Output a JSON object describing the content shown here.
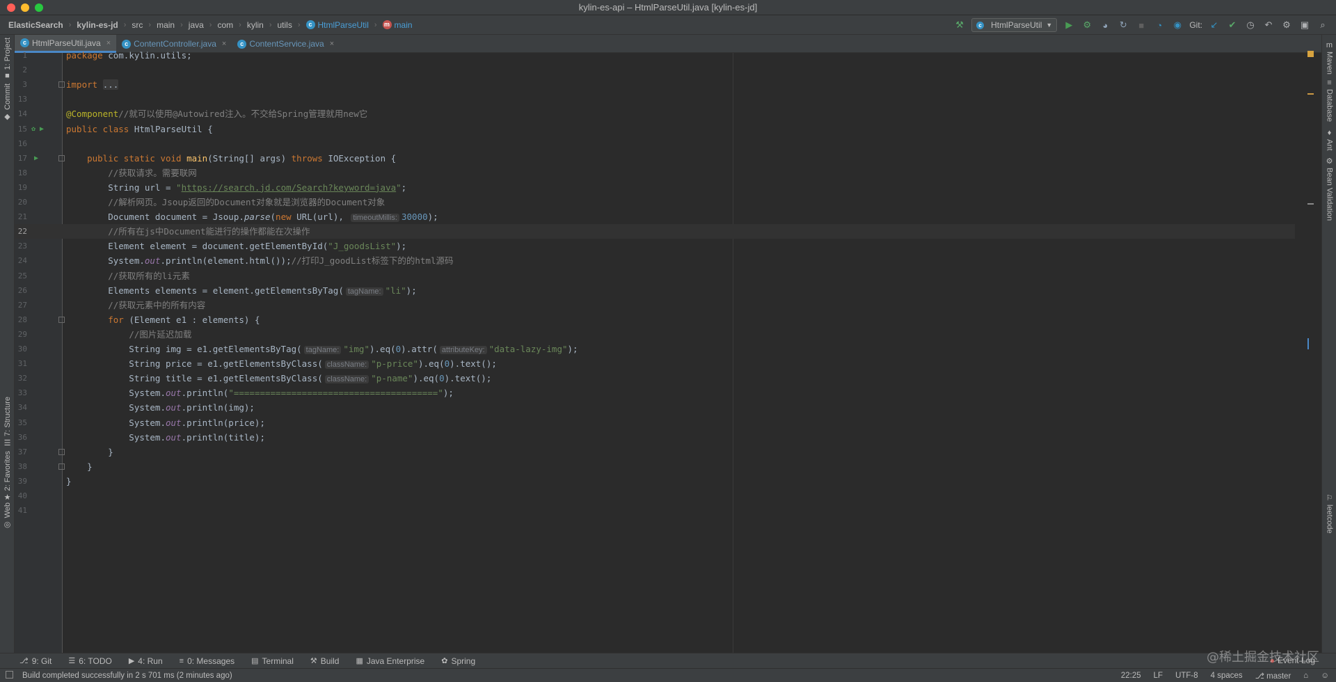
{
  "window": {
    "title": "kylin-es-api – HtmlParseUtil.java [kylin-es-jd]"
  },
  "breadcrumbs": [
    {
      "label": "ElasticSearch",
      "bold": true
    },
    {
      "label": "kylin-es-jd",
      "bold": true
    },
    {
      "label": "src"
    },
    {
      "label": "main"
    },
    {
      "label": "java"
    },
    {
      "label": "com"
    },
    {
      "label": "kylin"
    },
    {
      "label": "utils"
    },
    {
      "label": "HtmlParseUtil",
      "icon": "class-icon"
    },
    {
      "label": "main",
      "icon": "method-icon"
    }
  ],
  "toolbar": {
    "run_config": "HtmlParseUtil",
    "git_label": "Git:"
  },
  "left_sidebar": [
    {
      "label": "1: Project",
      "icon": "folder-icon"
    },
    {
      "label": "Commit",
      "icon": "commit-icon"
    },
    {
      "label": "7: Structure",
      "icon": "structure-icon"
    },
    {
      "label": "2: Favorites",
      "icon": "star-icon"
    },
    {
      "label": "Web",
      "icon": "globe-icon"
    }
  ],
  "right_sidebar": [
    {
      "label": "Maven",
      "icon": "maven-icon"
    },
    {
      "label": "Database",
      "icon": "database-icon"
    },
    {
      "label": "Ant",
      "icon": "ant-icon"
    },
    {
      "label": "Bean Validation",
      "icon": "bean-icon"
    },
    {
      "label": "leetcode",
      "icon": "leetcode-icon"
    }
  ],
  "tabs": [
    {
      "label": "HtmlParseUtil.java",
      "active": true
    },
    {
      "label": "ContentController.java",
      "active": false
    },
    {
      "label": "ContentService.java",
      "active": false
    }
  ],
  "code_lines": [
    {
      "n": "1",
      "tokens": [
        [
          "kw",
          "package "
        ],
        [
          "id",
          "com.kylin.utils;"
        ]
      ]
    },
    {
      "n": "2",
      "tokens": []
    },
    {
      "n": "3",
      "tokens": [
        [
          "kw",
          "import "
        ],
        [
          "fold",
          "..."
        ]
      ]
    },
    {
      "n": "13",
      "tokens": []
    },
    {
      "n": "14",
      "tokens": [
        [
          "ann",
          "@Component"
        ],
        [
          "cm",
          "//就可以使用@Autowired注入。不交给Spring管理就用new它"
        ]
      ]
    },
    {
      "n": "15",
      "tokens": [
        [
          "kw",
          "public class "
        ],
        [
          "id",
          "HtmlParseUtil {"
        ]
      ]
    },
    {
      "n": "16",
      "tokens": []
    },
    {
      "n": "17",
      "tokens": [
        [
          "id",
          "    "
        ],
        [
          "kw",
          "public static void "
        ],
        [
          "fn",
          "main"
        ],
        [
          "id",
          "(String[] args) "
        ],
        [
          "kw",
          "throws "
        ],
        [
          "id",
          "IOException {"
        ]
      ]
    },
    {
      "n": "18",
      "tokens": [
        [
          "id",
          "        "
        ],
        [
          "cm",
          "//获取请求。需要联网"
        ]
      ]
    },
    {
      "n": "19",
      "tokens": [
        [
          "id",
          "        String url = "
        ],
        [
          "str",
          "\""
        ],
        [
          "url",
          "https://search.jd.com/Search?keyword=java"
        ],
        [
          "str",
          "\""
        ],
        [
          "id",
          ";"
        ]
      ]
    },
    {
      "n": "20",
      "tokens": [
        [
          "id",
          "        "
        ],
        [
          "cm",
          "//解析网页。Jsoup返回的Document对象就是浏览器的Document对象"
        ]
      ]
    },
    {
      "n": "21",
      "tokens": [
        [
          "id",
          "        Document document = Jsoup."
        ],
        [
          "it",
          "parse"
        ],
        [
          "id",
          "("
        ],
        [
          "kw",
          "new "
        ],
        [
          "id",
          "URL(url), "
        ],
        [
          "hint",
          "timeoutMillis:"
        ],
        [
          "num",
          "30000"
        ],
        [
          "id",
          ");"
        ]
      ]
    },
    {
      "n": "22",
      "tokens": [
        [
          "id",
          "        "
        ],
        [
          "cm",
          "//所有在js中Document能进行的操作都能在次操作"
        ]
      ]
    },
    {
      "n": "23",
      "tokens": [
        [
          "id",
          "        Element element = document.getElementById("
        ],
        [
          "str",
          "\"J_goodsList\""
        ],
        [
          "id",
          ");"
        ]
      ]
    },
    {
      "n": "24",
      "tokens": [
        [
          "id",
          "        System."
        ],
        [
          "st",
          "out"
        ],
        [
          "id",
          ".println(element.html());"
        ],
        [
          "cm",
          "//打印J_goodList标签下的的html源码"
        ]
      ]
    },
    {
      "n": "25",
      "tokens": [
        [
          "id",
          "        "
        ],
        [
          "cm",
          "//获取所有的li元素"
        ]
      ]
    },
    {
      "n": "26",
      "tokens": [
        [
          "id",
          "        Elements elements = element.getElementsByTag("
        ],
        [
          "hint",
          "tagName:"
        ],
        [
          "str",
          "\"li\""
        ],
        [
          "id",
          ");"
        ]
      ]
    },
    {
      "n": "27",
      "tokens": [
        [
          "id",
          "        "
        ],
        [
          "cm",
          "//获取元素中的所有内容"
        ]
      ]
    },
    {
      "n": "28",
      "tokens": [
        [
          "id",
          "        "
        ],
        [
          "kw",
          "for "
        ],
        [
          "id",
          "(Element e1 : elements) {"
        ]
      ]
    },
    {
      "n": "29",
      "tokens": [
        [
          "id",
          "            "
        ],
        [
          "cm",
          "//图片延迟加载"
        ]
      ]
    },
    {
      "n": "30",
      "tokens": [
        [
          "id",
          "            String img = e1.getElementsByTag("
        ],
        [
          "hint",
          "tagName:"
        ],
        [
          "str",
          "\"img\""
        ],
        [
          "id",
          ").eq("
        ],
        [
          "num",
          "0"
        ],
        [
          "id",
          ").attr("
        ],
        [
          "hint",
          "attributeKey:"
        ],
        [
          "str",
          "\"data-lazy-img\""
        ],
        [
          "id",
          ");"
        ]
      ]
    },
    {
      "n": "31",
      "tokens": [
        [
          "id",
          "            String price = e1.getElementsByClass("
        ],
        [
          "hint",
          "className:"
        ],
        [
          "str",
          "\"p-price\""
        ],
        [
          "id",
          ").eq("
        ],
        [
          "num",
          "0"
        ],
        [
          "id",
          ").text();"
        ]
      ]
    },
    {
      "n": "32",
      "tokens": [
        [
          "id",
          "            String title = e1.getElementsByClass("
        ],
        [
          "hint",
          "className:"
        ],
        [
          "str",
          "\"p-name\""
        ],
        [
          "id",
          ").eq("
        ],
        [
          "num",
          "0"
        ],
        [
          "id",
          ").text();"
        ]
      ]
    },
    {
      "n": "33",
      "tokens": [
        [
          "id",
          "            System."
        ],
        [
          "st",
          "out"
        ],
        [
          "id",
          ".println("
        ],
        [
          "str",
          "\"=======================================\""
        ],
        [
          "id",
          ");"
        ]
      ]
    },
    {
      "n": "34",
      "tokens": [
        [
          "id",
          "            System."
        ],
        [
          "st",
          "out"
        ],
        [
          "id",
          ".println(img);"
        ]
      ]
    },
    {
      "n": "35",
      "tokens": [
        [
          "id",
          "            System."
        ],
        [
          "st",
          "out"
        ],
        [
          "id",
          ".println(price);"
        ]
      ]
    },
    {
      "n": "36",
      "tokens": [
        [
          "id",
          "            System."
        ],
        [
          "st",
          "out"
        ],
        [
          "id",
          ".println(title);"
        ]
      ]
    },
    {
      "n": "37",
      "tokens": [
        [
          "id",
          "        }"
        ]
      ]
    },
    {
      "n": "38",
      "tokens": [
        [
          "id",
          "    }"
        ]
      ]
    },
    {
      "n": "39",
      "tokens": [
        [
          "id",
          "}"
        ]
      ]
    },
    {
      "n": "40",
      "tokens": []
    },
    {
      "n": "41",
      "tokens": []
    }
  ],
  "current_line": "22",
  "bottom_tabs": [
    {
      "label": "9: Git",
      "icon": "git-icon"
    },
    {
      "label": "6: TODO",
      "icon": "todo-icon"
    },
    {
      "label": "4: Run",
      "icon": "run-icon"
    },
    {
      "label": "0: Messages",
      "icon": "messages-icon"
    },
    {
      "label": "Terminal",
      "icon": "terminal-icon"
    },
    {
      "label": "Build",
      "icon": "build-icon"
    },
    {
      "label": "Java Enterprise",
      "icon": "enterprise-icon"
    },
    {
      "label": "Spring",
      "icon": "spring-icon"
    }
  ],
  "event_log": "Event Log",
  "watermark": "@稀土掘金技术社区",
  "status": {
    "message": "Build completed successfully in 2 s 701 ms (2 minutes ago)",
    "position": "22:25",
    "line_sep": "LF",
    "encoding": "UTF-8",
    "indent": "4 spaces",
    "branch": "master"
  },
  "colors": {
    "kw": "#cc7832",
    "id": "#a9b7c6",
    "cm": "#808080",
    "str": "#6a8759",
    "url": "#6a8759",
    "num": "#6897bb",
    "ann": "#bbb529",
    "fn": "#ffc66d",
    "st": "#9876aa",
    "accent": "#4a88c7"
  }
}
